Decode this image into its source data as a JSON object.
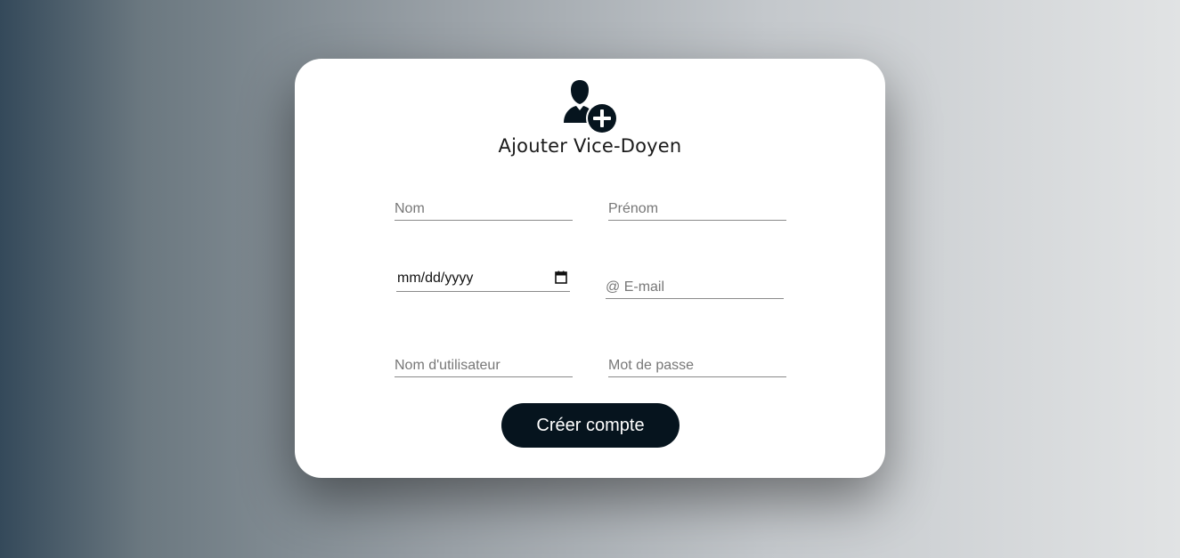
{
  "form": {
    "title": "Ajouter Vice-Doyen",
    "icon": "user-add-icon",
    "fields": {
      "nom_placeholder": "Nom",
      "prenom_placeholder": "Prénom",
      "date_value": "mm/dd/yyyy",
      "email_placeholder": "@ E-mail",
      "username_placeholder": "Nom d'utilisateur",
      "password_placeholder": "Mot de passe"
    },
    "submit_label": "Créer compte"
  },
  "colors": {
    "accent": "#06141e",
    "card": "#ffffff",
    "gradient_start": "#34495a",
    "gradient_end": "#e1e3e4"
  }
}
